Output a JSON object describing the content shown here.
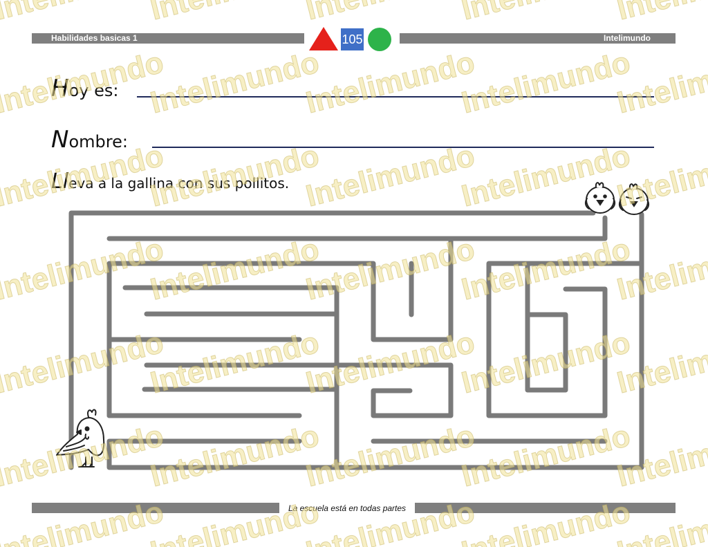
{
  "header": {
    "left_label": "Habilidades basicas 1",
    "right_label": "Intelimundo",
    "page_number": "105",
    "triangle_color": "#e5211b",
    "circle_color": "#2db34a"
  },
  "form": {
    "date_initial": "H",
    "date_rest": "oy es:",
    "name_initial": "N",
    "name_rest": "ombre:"
  },
  "instruction": {
    "initial": "Ll",
    "rest": "eva a la gallina con sus pollitos."
  },
  "footer": {
    "text": "La escuela está en todas partes"
  },
  "watermark": {
    "text": "Intelimundo"
  },
  "illustrations": {
    "hen": "hen-icon",
    "chicks": [
      "chick-icon",
      "chick-icon"
    ]
  }
}
